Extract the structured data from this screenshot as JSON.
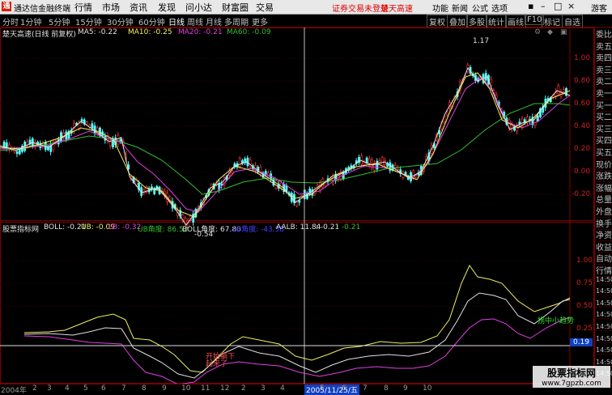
{
  "titlebar": {
    "logo": "通",
    "app_name": "通达信金融终端",
    "menu": [
      "行情",
      "市场",
      "资讯",
      "发现",
      "问小达",
      "财富圈",
      "交易"
    ],
    "login_status": "证券交易未登录",
    "stock_name": "楚天高速",
    "right_menu": [
      "功能",
      "新闻",
      "公式",
      "选项"
    ],
    "guest": "游客"
  },
  "toolbar": {
    "periods": [
      "分时",
      "1分钟",
      "5分钟",
      "15分钟",
      "30分钟",
      "60分钟",
      "日线",
      "周线",
      "月线",
      "多周期",
      "更多"
    ],
    "active_period": "日线",
    "right_buttons": [
      "复权",
      "叠加",
      "多股",
      "统计",
      "画线",
      "F10",
      "标记",
      "自选"
    ]
  },
  "main_chart": {
    "title": "楚天高速(日线 前复权)",
    "ma": [
      {
        "label": "MA5: -0.22",
        "color": "#e0e0e0"
      },
      {
        "label": "MA10: -0.25",
        "color": "#f0f060"
      },
      {
        "label": "MA20: -0.21",
        "color": "#e040e0"
      },
      {
        "label": "MA60: -0.09",
        "color": "#30c030"
      }
    ],
    "high_label": "1.17",
    "low_label": "-0.54",
    "plus_sign": "+自选",
    "y_ticks": [
      "1.00",
      "0.80",
      "0.60",
      "0.40",
      "0.20",
      "0.00",
      "-0.20"
    ]
  },
  "indicator": {
    "title": "股票指标网",
    "values": [
      {
        "label": "BOLL: -0.21",
        "color": "#e0e0e0"
      },
      {
        "label": "UB: -0.09",
        "color": "#f0f060"
      },
      {
        "label": "LB: -0.32",
        "color": "#e040e0"
      },
      {
        "label": "UB角度: 86.52",
        "color": "#30c030"
      },
      {
        "label": "BOLL角度: 67.80",
        "color": "#e0e0e0"
      },
      {
        "label": "LB角度: -43.58",
        "color": "#4040ff"
      },
      {
        "label": "AALB: 11.84",
        "color": "#e0e0e0"
      },
      {
        "label": ": -0.21",
        "color": "#e0e0e0"
      },
      {
        "label": ": -0.21",
        "color": "#30c030"
      }
    ],
    "annotation_buy": "开始躺下",
    "annotation_sell": "起来了",
    "annotation_green": "拐中小趋势",
    "price_tag": "0.19",
    "y_ticks": [
      "1.00",
      "0.75",
      "0.50",
      "0.25"
    ]
  },
  "right_panel": [
    "委比",
    "卖五",
    "卖四",
    "卖三",
    "卖二",
    "卖一",
    "买一",
    "买二",
    "买三",
    "买四",
    "买五",
    "现价",
    "涨跌",
    "涨幅",
    "总量",
    "外盘",
    "换手",
    "净资",
    "收益",
    "自动",
    "行情",
    "14:50",
    "14:50",
    "14:50",
    "14:50",
    "14:50",
    "14:50",
    "14:50",
    "14:50",
    "14:50"
  ],
  "bottom_bar": {
    "year": "2004年",
    "months": [
      "2",
      "3",
      "4",
      "5",
      "6",
      "7",
      "8",
      "9",
      "10",
      "11",
      "12",
      "2",
      "3",
      "4",
      "5",
      "6",
      "7",
      "8",
      "9",
      "10"
    ],
    "cursor_date": "2005/11/25/五"
  },
  "watermark": {
    "line1": "股票指标网",
    "line2": "www.7gpzb.com"
  }
}
